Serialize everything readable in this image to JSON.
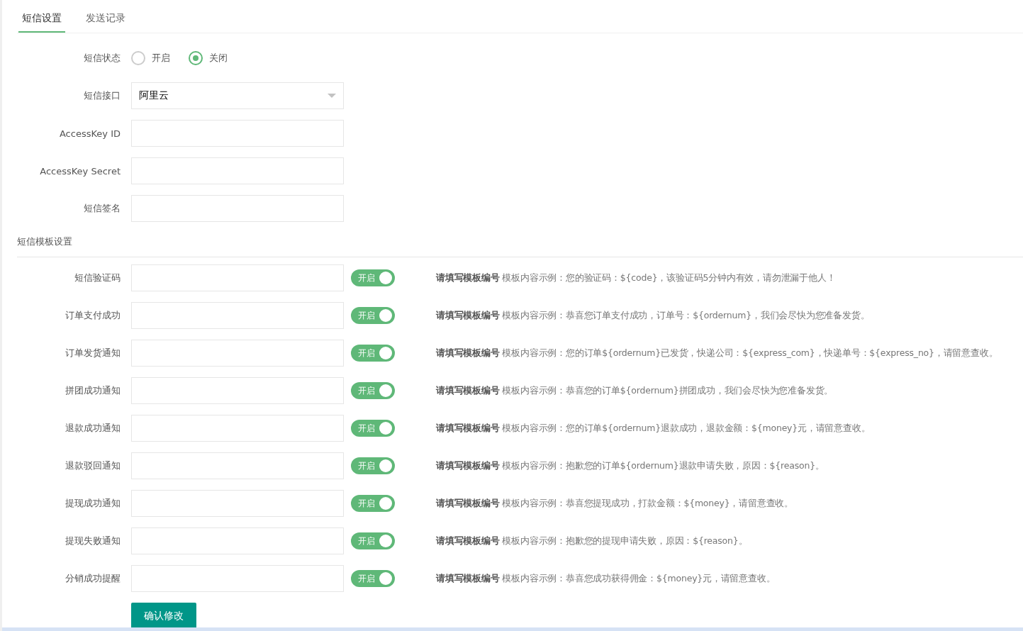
{
  "tabs": [
    {
      "label": "短信设置",
      "selected": true
    },
    {
      "label": "发送记录",
      "selected": false
    }
  ],
  "settings": {
    "status": {
      "label": "短信状态",
      "options": [
        {
          "label": "开启",
          "selected": false
        },
        {
          "label": "关闭",
          "selected": true
        }
      ]
    },
    "provider": {
      "label": "短信接口",
      "value": "阿里云"
    },
    "fields": [
      {
        "label": "AccessKey ID"
      },
      {
        "label": "AccessKey Secret"
      },
      {
        "label": "短信签名"
      }
    ]
  },
  "template_section": {
    "title": "短信模板设置"
  },
  "templates": [
    {
      "label": "短信验证码",
      "switch_label": "开启",
      "on": true,
      "hint": "**请填写模板编号** 模板内容示例：您的验证码：${code}，该验证码5分钟内有效，请勿泄漏于他人！"
    },
    {
      "label": "订单支付成功",
      "switch_label": "开启",
      "on": true,
      "hint": "**请填写模板编号** 模板内容示例：恭喜您订单支付成功，订单号：${ordernum}，我们会尽快为您准备发货。"
    },
    {
      "label": "订单发货通知",
      "switch_label": "开启",
      "on": true,
      "hint": "**请填写模板编号** 模板内容示例：您的订单${ordernum}已发货，快递公司：${express_com}，快递单号：${express_no}，请留意查收。"
    },
    {
      "label": "拼团成功通知",
      "switch_label": "开启",
      "on": true,
      "hint": "**请填写模板编号** 模板内容示例：恭喜您的订单${ordernum}拼团成功，我们会尽快为您准备发货。"
    },
    {
      "label": "退款成功通知",
      "switch_label": "开启",
      "on": true,
      "hint": "**请填写模板编号** 模板内容示例：您的订单${ordernum}退款成功，退款金额：${money}元，请留意查收。"
    },
    {
      "label": "退款驳回通知",
      "switch_label": "开启",
      "on": true,
      "hint": "**请填写模板编号** 模板内容示例：抱歉您的订单${ordernum}退款申请失败，原因：${reason}。"
    },
    {
      "label": "提现成功通知",
      "switch_label": "开启",
      "on": true,
      "hint": "**请填写模板编号** 模板内容示例：恭喜您提现成功，打款金额：${money}，请留意查收。"
    },
    {
      "label": "提现失败通知",
      "switch_label": "开启",
      "on": true,
      "hint": "**请填写模板编号** 模板内容示例：抱歉您的提现申请失败，原因：${reason}。"
    },
    {
      "label": "分销成功提醒",
      "switch_label": "开启",
      "on": true,
      "hint": "**请填写模板编号** 模板内容示例：恭喜您成功获得佣金：${money}元，请留意查收。"
    }
  ],
  "submit_button": "确认修改"
}
